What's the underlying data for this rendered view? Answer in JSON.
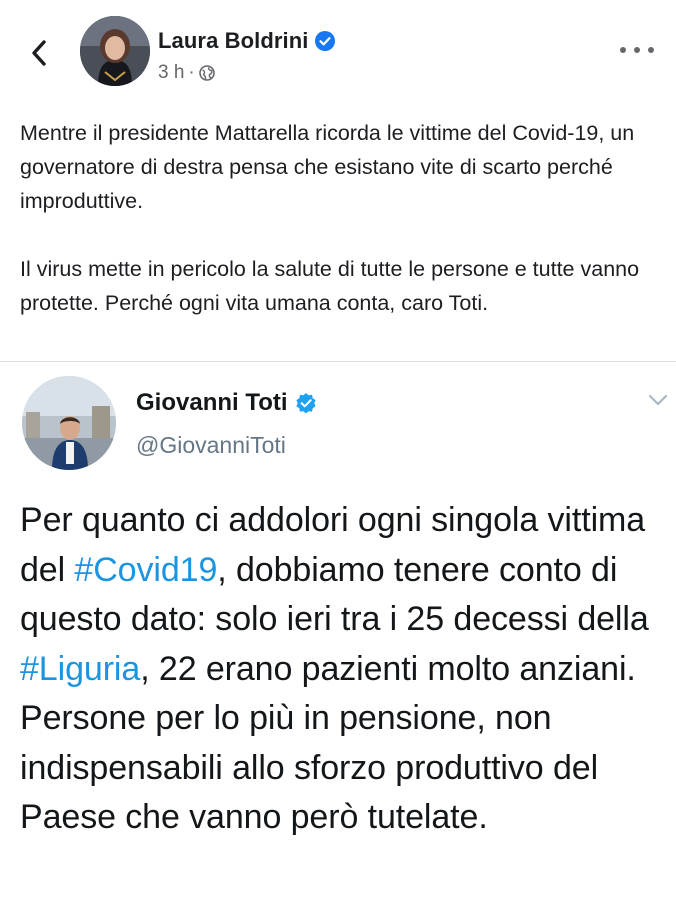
{
  "post": {
    "author": "Laura Boldrini",
    "time": "3 h",
    "separator": "·",
    "paragraphs": [
      "Mentre il presidente Mattarella ricorda le vittime del Covid-19, un governatore di destra pensa che esistano vite di scarto perché improduttive.",
      "Il virus mette in pericolo la salute di tutte le persone e tutte vanno protette. Perché ogni vita umana conta, caro Toti."
    ]
  },
  "tweet": {
    "name": "Giovanni Toti",
    "handle": "@GiovanniToti",
    "body": {
      "t1": "Per quanto ci addolori ogni singola vittima del ",
      "h1": "#Covid19",
      "t2": ", dobbiamo tenere conto di questo dato: solo ieri tra i 25 decessi della ",
      "h2": "#Liguria",
      "t3": ", 22 erano pazienti molto anziani. Persone per lo più in pensione, non indispensabili allo sforzo produttivo del Paese che vanno però tutelate."
    }
  },
  "colors": {
    "facebook_blue": "#1877f2",
    "twitter_blue": "#1da1f2",
    "hashtag": "#1b95e0",
    "secondary_text": "#65676b"
  },
  "icons": [
    "back-arrow-icon",
    "verified-badge-icon",
    "globe-icon",
    "more-options-icon",
    "chevron-down-icon"
  ]
}
